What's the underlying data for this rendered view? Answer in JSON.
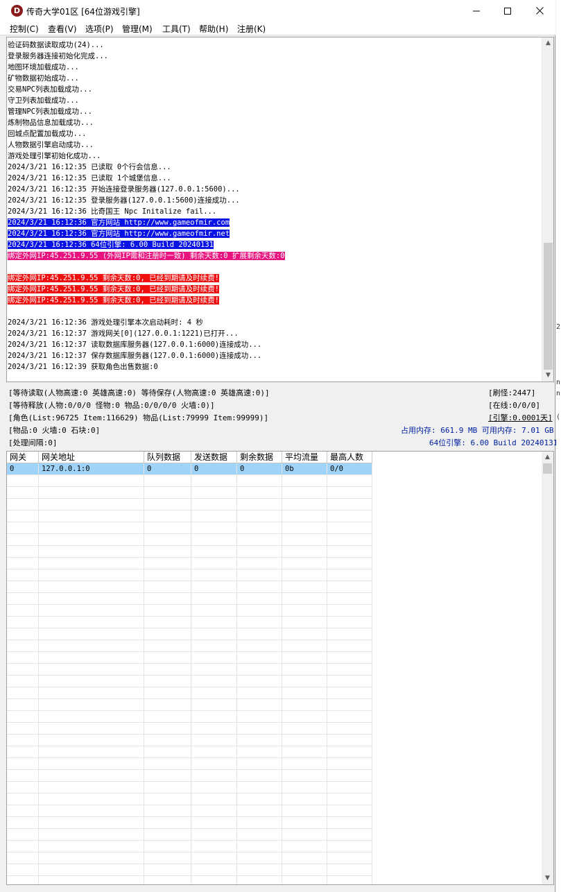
{
  "window": {
    "icon_letter": "D",
    "title": "传奇大学01区 [64位游戏引擎]"
  },
  "menu": [
    {
      "label": "控制(C)"
    },
    {
      "label": "查看(V)"
    },
    {
      "label": "选项(P)"
    },
    {
      "label": "管理(M)"
    },
    {
      "label": "工具(T)"
    },
    {
      "label": "帮助(H)"
    },
    {
      "label": "注册(K)"
    }
  ],
  "log": {
    "lines": [
      {
        "text": "验证码数据读取成功(24)...",
        "style": ""
      },
      {
        "text": "登录服务器连接初始化完成...",
        "style": ""
      },
      {
        "text": "地图环境加载成功...",
        "style": ""
      },
      {
        "text": "矿物数据初始成功...",
        "style": ""
      },
      {
        "text": "交易NPC列表加载成功...",
        "style": ""
      },
      {
        "text": "守卫列表加载成功...",
        "style": ""
      },
      {
        "text": "管理NPC列表加载成功...",
        "style": ""
      },
      {
        "text": "炼制物品信息加载成功...",
        "style": ""
      },
      {
        "text": "回城点配置加载成功...",
        "style": ""
      },
      {
        "text": "人物数据引擎启动成功...",
        "style": ""
      },
      {
        "text": "游戏处理引擎初始化成功...",
        "style": ""
      },
      {
        "text": "2024/3/21 16:12:35 已读取 0个行会信息...",
        "style": ""
      },
      {
        "text": "2024/3/21 16:12:35 已读取 1个城堡信息...",
        "style": ""
      },
      {
        "text": "2024/3/21 16:12:35 开始连接登录服务器(127.0.0.1:5600)...",
        "style": ""
      },
      {
        "text": "2024/3/21 16:12:35 登录服务器(127.0.0.1:5600)连接成功...",
        "style": ""
      },
      {
        "text": "2024/3/21 16:12:36 比奇国王 Npc Initalize fail...",
        "style": ""
      },
      {
        "text": "2024/3/21 16:12:36 官方网站 http://www.gameofmir.com",
        "style": "blue"
      },
      {
        "text": "2024/3/21 16:12:36 官方网站 http://www.gameofmir.net",
        "style": "blue"
      },
      {
        "text": "2024/3/21 16:12:36 64位引擎: 6.00 Build 20240131",
        "style": "blue"
      },
      {
        "text": "绑定外网IP:45.251.9.55 (外网IP需和注册时一致) 剩余天数:0 扩展剩余天数:0",
        "style": "pink"
      },
      {
        "text": "",
        "style": ""
      },
      {
        "text": "绑定外网IP:45.251.9.55 剩余天数:0, 已经到期请及时续费!",
        "style": "red"
      },
      {
        "text": "绑定外网IP:45.251.9.55 剩余天数:0, 已经到期请及时续费!",
        "style": "red"
      },
      {
        "text": "绑定外网IP:45.251.9.55 剩余天数:0, 已经到期请及时续费!",
        "style": "red"
      },
      {
        "text": "",
        "style": ""
      },
      {
        "text": "2024/3/21 16:12:36 游戏处理引擎本次启动耗时: 4 秒",
        "style": ""
      },
      {
        "text": "2024/3/21 16:12:37 游戏网关[0](127.0.0.1:1221)已打开...",
        "style": ""
      },
      {
        "text": "2024/3/21 16:12:37 读取数据库服务器(127.0.0.1:6000)连接成功...",
        "style": ""
      },
      {
        "text": "2024/3/21 16:12:37 保存数据库服务器(127.0.0.1:6000)连接成功...",
        "style": ""
      },
      {
        "text": "2024/3/21 16:12:39 获取角色出售数据:0",
        "style": ""
      }
    ]
  },
  "status": {
    "wait_read": "[等待读取(人物高速:0 英雄高速:0) 等待保存(人物高速:0 英雄高速:0)]",
    "refresh_monster": "[刷怪:2447]",
    "wait_release": "[等待释放(人物:0/0/0 怪物:0 物品:0/0/0/0 火墙:0)]",
    "online": "[在线:0/0/0]",
    "role_list": "[角色(List:96725 Item:116629) 物品(List:79999 Item:99999)]",
    "engine": "[引擎:0.0001天]",
    "items": "[物品:0 火墙:0 石块:0]",
    "memory": "占用内存: 661.9 MB 可用内存: 7.01 GB",
    "interval": "[处理间隔:0]",
    "engine_version": "64位引擎: 6.00 Build 20240131"
  },
  "grid": {
    "headers": [
      "网关",
      "网关地址",
      "队列数据",
      "发送数据",
      "剩余数据",
      "平均流量",
      "最高人数"
    ],
    "rows": [
      [
        "0",
        "127.0.0.1:0",
        "0",
        "0",
        "0",
        "0b",
        "0/0"
      ]
    ]
  },
  "side_marks": [
    "2",
    "n",
    "n",
    "(I"
  ]
}
